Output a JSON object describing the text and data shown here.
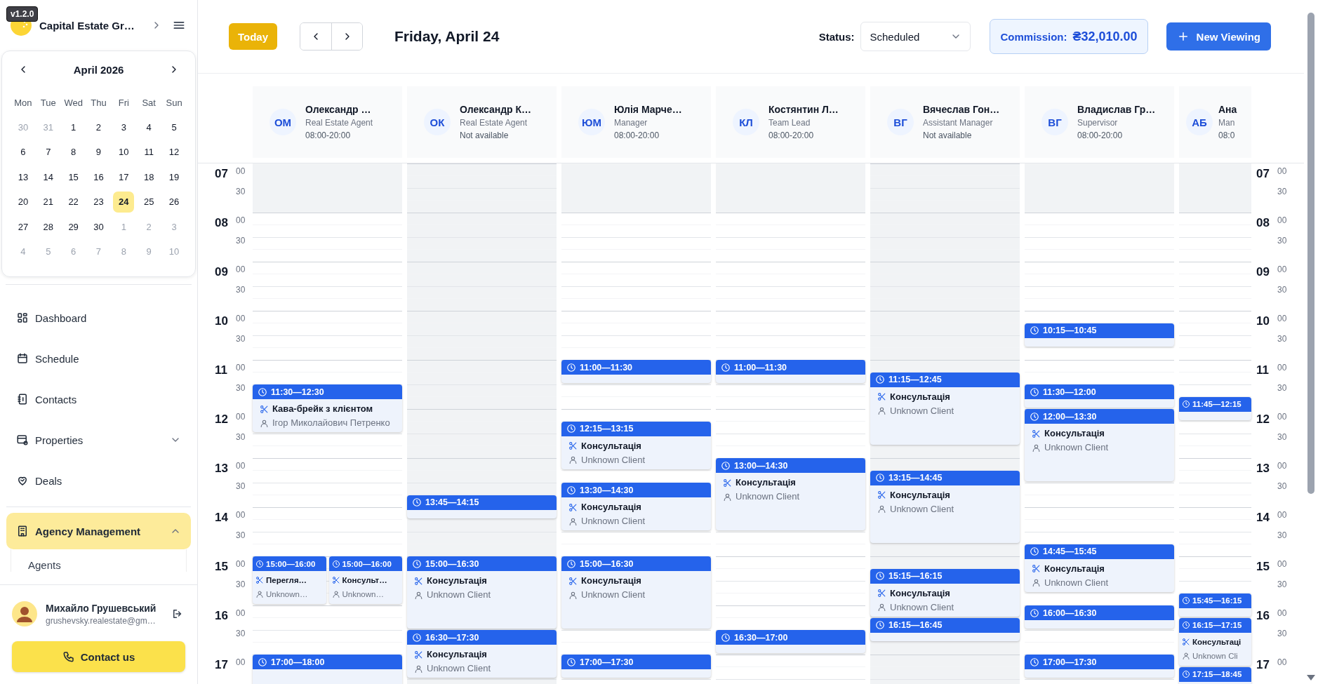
{
  "app": {
    "version": "v1.2.0",
    "company": "Capital Estate Gr…"
  },
  "mini_calendar": {
    "title": "April 2026",
    "weekdays": [
      "Mon",
      "Tue",
      "Wed",
      "Thu",
      "Fri",
      "Sat",
      "Sun"
    ],
    "weeks": [
      [
        {
          "day": "30",
          "muted": true,
          "selected": false
        },
        {
          "day": "31",
          "muted": true,
          "selected": false
        },
        {
          "day": "1",
          "muted": false,
          "selected": false
        },
        {
          "day": "2",
          "muted": false,
          "selected": false
        },
        {
          "day": "3",
          "muted": false,
          "selected": false
        },
        {
          "day": "4",
          "muted": false,
          "selected": false
        },
        {
          "day": "5",
          "muted": false,
          "selected": false
        }
      ],
      [
        {
          "day": "6",
          "muted": false,
          "selected": false
        },
        {
          "day": "7",
          "muted": false,
          "selected": false
        },
        {
          "day": "8",
          "muted": false,
          "selected": false
        },
        {
          "day": "9",
          "muted": false,
          "selected": false
        },
        {
          "day": "10",
          "muted": false,
          "selected": false
        },
        {
          "day": "11",
          "muted": false,
          "selected": false
        },
        {
          "day": "12",
          "muted": false,
          "selected": false
        }
      ],
      [
        {
          "day": "13",
          "muted": false,
          "selected": false
        },
        {
          "day": "14",
          "muted": false,
          "selected": false
        },
        {
          "day": "15",
          "muted": false,
          "selected": false
        },
        {
          "day": "16",
          "muted": false,
          "selected": false
        },
        {
          "day": "17",
          "muted": false,
          "selected": false
        },
        {
          "day": "18",
          "muted": false,
          "selected": false
        },
        {
          "day": "19",
          "muted": false,
          "selected": false
        }
      ],
      [
        {
          "day": "20",
          "muted": false,
          "selected": false
        },
        {
          "day": "21",
          "muted": false,
          "selected": false
        },
        {
          "day": "22",
          "muted": false,
          "selected": false
        },
        {
          "day": "23",
          "muted": false,
          "selected": false
        },
        {
          "day": "24",
          "muted": false,
          "selected": true
        },
        {
          "day": "25",
          "muted": false,
          "selected": false
        },
        {
          "day": "26",
          "muted": false,
          "selected": false
        }
      ],
      [
        {
          "day": "27",
          "muted": false,
          "selected": false
        },
        {
          "day": "28",
          "muted": false,
          "selected": false
        },
        {
          "day": "29",
          "muted": false,
          "selected": false
        },
        {
          "day": "30",
          "muted": false,
          "selected": false
        },
        {
          "day": "1",
          "muted": true,
          "selected": false
        },
        {
          "day": "2",
          "muted": true,
          "selected": false
        },
        {
          "day": "3",
          "muted": true,
          "selected": false
        }
      ],
      [
        {
          "day": "4",
          "muted": true,
          "selected": false
        },
        {
          "day": "5",
          "muted": true,
          "selected": false
        },
        {
          "day": "6",
          "muted": true,
          "selected": false
        },
        {
          "day": "7",
          "muted": true,
          "selected": false
        },
        {
          "day": "8",
          "muted": true,
          "selected": false
        },
        {
          "day": "9",
          "muted": true,
          "selected": false
        },
        {
          "day": "10",
          "muted": true,
          "selected": false
        }
      ]
    ]
  },
  "nav": [
    {
      "kind": "link",
      "label": "Dashboard",
      "selected": false
    },
    {
      "kind": "link",
      "label": "Schedule",
      "selected": false
    },
    {
      "kind": "link",
      "label": "Contacts",
      "selected": false
    },
    {
      "kind": "group",
      "label": "Properties",
      "selected": false,
      "expanded": false
    },
    {
      "kind": "link",
      "label": "Deals",
      "selected": false
    },
    {
      "kind": "group",
      "label": "Agency Management",
      "selected": true,
      "expanded": true,
      "children": [
        {
          "label": "Agents",
          "selected": false
        }
      ]
    }
  ],
  "user": {
    "name": "Михайло Грушевський",
    "email": "grushevsky.realestate@gm…"
  },
  "contact_button": "Contact us",
  "toolbar": {
    "today": "Today",
    "date_title": "Friday, April 24",
    "status_label": "Status:",
    "status_value": "Scheduled",
    "commission_label": "Commission:",
    "commission_value": "₴32,010.00",
    "new_button": "New Viewing"
  },
  "time_axis_left": [
    {
      "hour": "07",
      "minutes": [
        "00",
        "30"
      ]
    },
    {
      "hour": "08",
      "minutes": [
        "00",
        "30"
      ]
    },
    {
      "hour": "09",
      "minutes": [
        "00",
        "30"
      ]
    },
    {
      "hour": "10",
      "minutes": [
        "00",
        "30"
      ]
    },
    {
      "hour": "11",
      "minutes": [
        "00",
        "30"
      ]
    },
    {
      "hour": "12",
      "minutes": [
        "00",
        "30"
      ]
    },
    {
      "hour": "13",
      "minutes": [
        "00",
        "30"
      ]
    },
    {
      "hour": "14",
      "minutes": [
        "00",
        "30"
      ]
    },
    {
      "hour": "15",
      "minutes": [
        "00",
        "30"
      ]
    },
    {
      "hour": "16",
      "minutes": [
        "00",
        "30"
      ]
    },
    {
      "hour": "17",
      "minutes": [
        "00"
      ]
    }
  ],
  "time_axis_right": [
    {
      "hour": "07",
      "minutes": [
        "00",
        "30"
      ]
    },
    {
      "hour": "08",
      "minutes": [
        "00",
        "30"
      ]
    },
    {
      "hour": "09",
      "minutes": [
        "00",
        "30"
      ]
    },
    {
      "hour": "10",
      "minutes": [
        "00",
        "30"
      ]
    },
    {
      "hour": "11",
      "minutes": [
        "00",
        "30"
      ]
    },
    {
      "hour": "12",
      "minutes": [
        "00",
        "30"
      ]
    },
    {
      "hour": "13",
      "minutes": [
        "00",
        "30"
      ]
    },
    {
      "hour": "14",
      "minutes": [
        "00",
        "30"
      ]
    },
    {
      "hour": "15",
      "minutes": [
        "00",
        "30"
      ]
    },
    {
      "hour": "16",
      "minutes": [
        "00",
        "30"
      ]
    },
    {
      "hour": "17",
      "minutes": [
        "00"
      ]
    }
  ],
  "agents": [
    {
      "initials": "ОМ",
      "name": "Олександр …",
      "role": "Real Estate Agent",
      "hours": "08:00-20:00",
      "available": true,
      "events": [
        {
          "time": "11:30—12:30",
          "title": "Кава-брейк з клієнтом",
          "client": "Ігор Миколайович Петренко"
        },
        {
          "time": "15:00—16:00",
          "title": "Перегля…",
          "client": "Unknown…"
        },
        {
          "time": "15:00—16:00",
          "title": "Консульт…",
          "client": "Unknown…"
        },
        {
          "time": "17:00—18:00"
        }
      ]
    },
    {
      "initials": "ОК",
      "name": "Олександр К…",
      "role": "Real Estate Agent",
      "hours": "Not available",
      "available": false,
      "events": [
        {
          "time": "13:45—14:15"
        },
        {
          "time": "15:00—16:30",
          "title": "Консультація",
          "client": "Unknown Client"
        },
        {
          "time": "16:30—17:30",
          "title": "Консультація",
          "client": "Unknown Client"
        }
      ]
    },
    {
      "initials": "ЮМ",
      "name": "Юлія Марче…",
      "role": "Manager",
      "hours": "08:00-20:00",
      "available": true,
      "events": [
        {
          "time": "11:00—11:30"
        },
        {
          "time": "12:15—13:15",
          "title": "Консультація",
          "client": "Unknown Client"
        },
        {
          "time": "13:30—14:30",
          "title": "Консультація",
          "client": "Unknown Client"
        },
        {
          "time": "15:00—16:30",
          "title": "Консультація",
          "client": "Unknown Client"
        },
        {
          "time": "17:00—17:30"
        }
      ]
    },
    {
      "initials": "КЛ",
      "name": "Костянтин Л…",
      "role": "Team Lead",
      "hours": "08:00-20:00",
      "available": true,
      "events": [
        {
          "time": "11:00—11:30"
        },
        {
          "time": "13:00—14:30",
          "title": "Консультація",
          "client": "Unknown Client"
        },
        {
          "time": "16:30—17:00"
        }
      ]
    },
    {
      "initials": "ВГ",
      "name": "Вячеслав Гон…",
      "role": "Assistant Manager",
      "hours": "Not available",
      "available": false,
      "events": [
        {
          "time": "11:15—12:45",
          "title": "Консультація",
          "client": "Unknown Client"
        },
        {
          "time": "13:15—14:45",
          "title": "Консультація",
          "client": "Unknown Client"
        },
        {
          "time": "15:15—16:15",
          "title": "Консультація",
          "client": "Unknown Client"
        },
        {
          "time": "16:15—16:45"
        }
      ]
    },
    {
      "initials": "ВГ",
      "name": "Владислав Гр…",
      "role": "Supervisor",
      "hours": "08:00-20:00",
      "available": true,
      "events": [
        {
          "time": "10:15—10:45"
        },
        {
          "time": "11:30—12:00"
        },
        {
          "time": "12:00—13:30",
          "title": "Консультація",
          "client": "Unknown Client"
        },
        {
          "time": "14:45—15:45",
          "title": "Консультація",
          "client": "Unknown Client"
        },
        {
          "time": "16:00—16:30"
        },
        {
          "time": "17:00—17:30"
        }
      ]
    },
    {
      "initials": "АБ",
      "name": "Ана",
      "role": "Man",
      "hours": "08:0",
      "available": true,
      "events": [
        {
          "time": "11:45—12:15"
        },
        {
          "time": "15:45—16:15"
        },
        {
          "time": "16:15—17:15",
          "title": "Консультаці",
          "client": "Unknown Cli"
        },
        {
          "time": "17:15—18:45"
        }
      ]
    }
  ]
}
